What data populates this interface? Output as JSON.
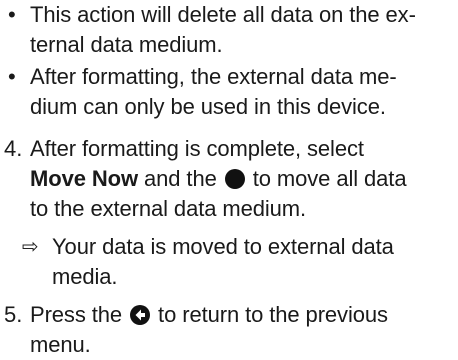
{
  "bullets": [
    {
      "marker": "•",
      "lines": [
        "This action will delete all data on the ex-",
        "ternal data medium."
      ]
    },
    {
      "marker": "•",
      "lines": [
        "After formatting, the external data me-",
        "dium can only be used in this device."
      ]
    }
  ],
  "step4": {
    "number": "4.",
    "line1": "After formatting is complete, select",
    "line2_bold": "Move Now",
    "line2_pre": " and the ",
    "line2_post": " to move all data",
    "line3": "to the external data medium.",
    "icon": "filled-circle-icon"
  },
  "result": {
    "marker": "⇨",
    "lines": [
      "Your data is moved to external data",
      "media."
    ]
  },
  "step5": {
    "number": "5.",
    "line1_pre": "Press the ",
    "line1_post": " to return to the previous",
    "line2": "menu.",
    "icon": "back-arrow-icon"
  }
}
